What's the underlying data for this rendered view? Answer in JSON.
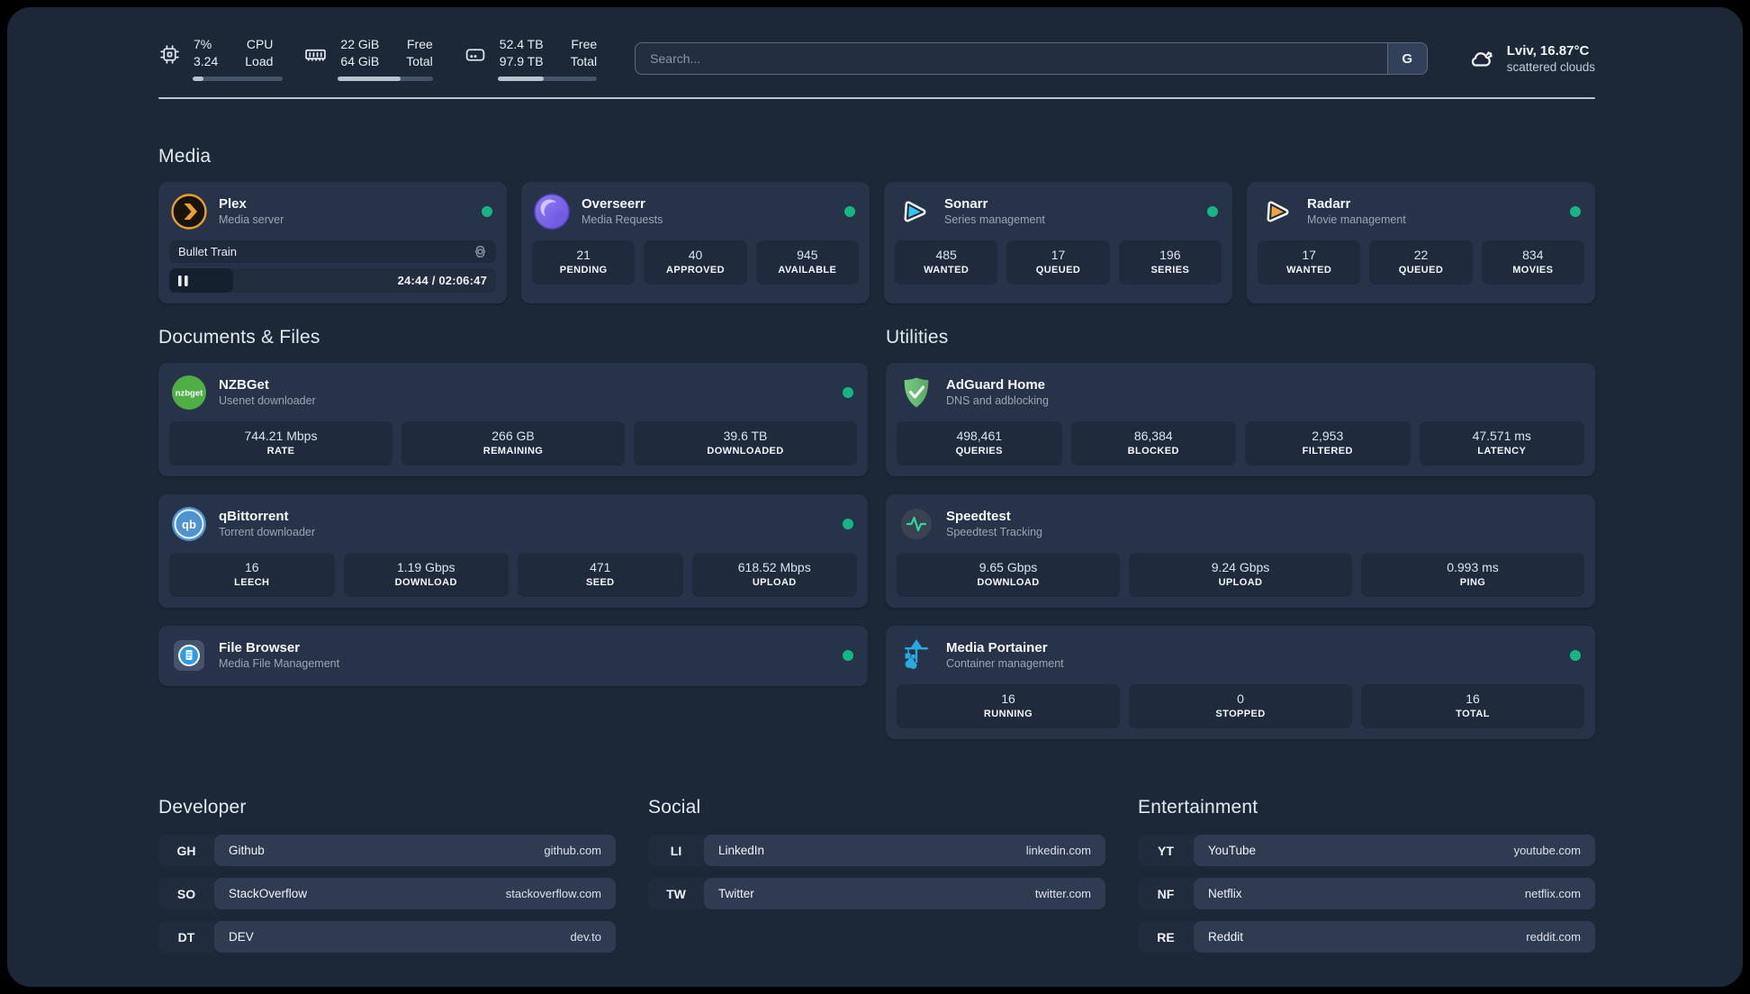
{
  "header": {
    "resources": [
      {
        "icon": "cpu-icon",
        "value_top": "7%",
        "value_bottom": "3.24",
        "label_top": "CPU",
        "label_bottom": "Load",
        "progress": 8
      },
      {
        "icon": "memory-icon",
        "value_top": "22 GiB",
        "value_bottom": "64 GiB",
        "label_top": "Free",
        "label_bottom": "Total",
        "progress": 66
      },
      {
        "icon": "disk-icon",
        "value_top": "52.4 TB",
        "value_bottom": "97.9 TB",
        "label_top": "Free",
        "label_bottom": "Total",
        "progress": 46
      }
    ],
    "search": {
      "placeholder": "Search...",
      "button_label": "G"
    },
    "weather": {
      "location": "Lviv, 16.87°C",
      "condition": "scattered clouds"
    }
  },
  "media": {
    "heading": "Media",
    "plex": {
      "title": "Plex",
      "subtitle": "Media server",
      "now_playing": {
        "title": "Bullet Train",
        "time": "24:44 / 02:06:47",
        "progress": 19.5
      }
    },
    "overseerr": {
      "title": "Overseerr",
      "subtitle": "Media Requests",
      "stats": [
        {
          "value": "21",
          "label": "PENDING"
        },
        {
          "value": "40",
          "label": "APPROVED"
        },
        {
          "value": "945",
          "label": "AVAILABLE"
        }
      ]
    },
    "sonarr": {
      "title": "Sonarr",
      "subtitle": "Series management",
      "stats": [
        {
          "value": "485",
          "label": "WANTED"
        },
        {
          "value": "17",
          "label": "QUEUED"
        },
        {
          "value": "196",
          "label": "SERIES"
        }
      ]
    },
    "radarr": {
      "title": "Radarr",
      "subtitle": "Movie management",
      "stats": [
        {
          "value": "17",
          "label": "WANTED"
        },
        {
          "value": "22",
          "label": "QUEUED"
        },
        {
          "value": "834",
          "label": "MOVIES"
        }
      ]
    }
  },
  "documents": {
    "heading": "Documents & Files",
    "nzbget": {
      "title": "NZBGet",
      "subtitle": "Usenet downloader",
      "stats": [
        {
          "value": "744.21 Mbps",
          "label": "RATE"
        },
        {
          "value": "266 GB",
          "label": "REMAINING"
        },
        {
          "value": "39.6 TB",
          "label": "DOWNLOADED"
        }
      ]
    },
    "qbittorrent": {
      "title": "qBittorrent",
      "subtitle": "Torrent downloader",
      "stats": [
        {
          "value": "16",
          "label": "LEECH"
        },
        {
          "value": "1.19 Gbps",
          "label": "DOWNLOAD"
        },
        {
          "value": "471",
          "label": "SEED"
        },
        {
          "value": "618.52 Mbps",
          "label": "UPLOAD"
        }
      ]
    },
    "filebrowser": {
      "title": "File Browser",
      "subtitle": "Media File Management"
    }
  },
  "utilities": {
    "heading": "Utilities",
    "adguard": {
      "title": "AdGuard Home",
      "subtitle": "DNS and adblocking",
      "stats": [
        {
          "value": "498,461",
          "label": "QUERIES"
        },
        {
          "value": "86,384",
          "label": "BLOCKED"
        },
        {
          "value": "2,953",
          "label": "FILTERED"
        },
        {
          "value": "47.571 ms",
          "label": "LATENCY"
        }
      ]
    },
    "speedtest": {
      "title": "Speedtest",
      "subtitle": "Speedtest Tracking",
      "stats": [
        {
          "value": "9.65 Gbps",
          "label": "DOWNLOAD"
        },
        {
          "value": "9.24 Gbps",
          "label": "UPLOAD"
        },
        {
          "value": "0.993 ms",
          "label": "PING"
        }
      ]
    },
    "portainer": {
      "title": "Media Portainer",
      "subtitle": "Container management",
      "stats": [
        {
          "value": "16",
          "label": "RUNNING"
        },
        {
          "value": "0",
          "label": "STOPPED"
        },
        {
          "value": "16",
          "label": "TOTAL"
        }
      ]
    }
  },
  "bookmarks": {
    "developer": {
      "heading": "Developer",
      "items": [
        {
          "abbr": "GH",
          "name": "Github",
          "url": "github.com"
        },
        {
          "abbr": "SO",
          "name": "StackOverflow",
          "url": "stackoverflow.com"
        },
        {
          "abbr": "DT",
          "name": "DEV",
          "url": "dev.to"
        }
      ]
    },
    "social": {
      "heading": "Social",
      "items": [
        {
          "abbr": "LI",
          "name": "LinkedIn",
          "url": "linkedin.com"
        },
        {
          "abbr": "TW",
          "name": "Twitter",
          "url": "twitter.com"
        }
      ]
    },
    "entertainment": {
      "heading": "Entertainment",
      "items": [
        {
          "abbr": "YT",
          "name": "YouTube",
          "url": "youtube.com"
        },
        {
          "abbr": "NF",
          "name": "Netflix",
          "url": "netflix.com"
        },
        {
          "abbr": "RE",
          "name": "Reddit",
          "url": "reddit.com"
        }
      ]
    }
  },
  "colors": {
    "status_online": "#17b583",
    "plex_accent": "#e8a22a",
    "sonarr_accent": "#36c3f5",
    "radarr_accent": "#f2a33c"
  }
}
